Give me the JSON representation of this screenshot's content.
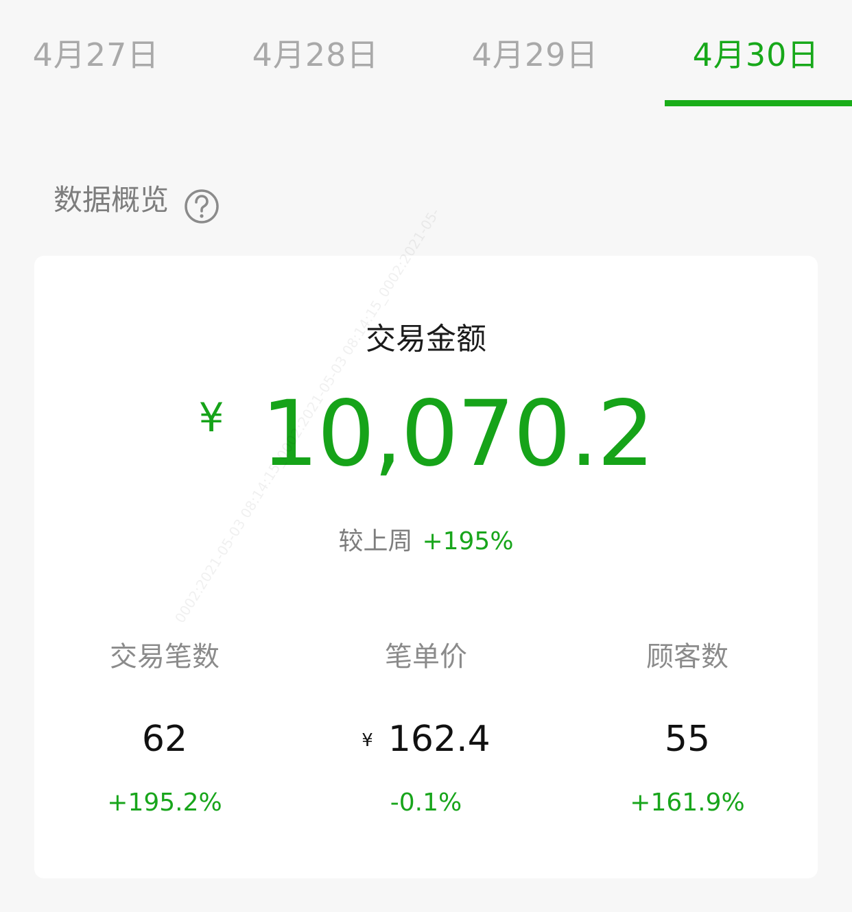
{
  "tabs": [
    {
      "label": "4月27日",
      "active": false
    },
    {
      "label": "4月28日",
      "active": false
    },
    {
      "label": "4月29日",
      "active": false
    },
    {
      "label": "4月30日",
      "active": true
    }
  ],
  "overview": {
    "title": "数据概览",
    "help_icon": "question-circle-icon"
  },
  "card": {
    "main_label": "交易金额",
    "currency": "¥",
    "amount": "10,070.2",
    "compare_label": "较上周",
    "compare_pct": "+195%",
    "metrics": [
      {
        "label": "交易笔数",
        "currency": "",
        "value": "62",
        "change": "+195.2%"
      },
      {
        "label": "笔单价",
        "currency": "¥",
        "value": "162.4",
        "change": "-0.1%"
      },
      {
        "label": "顾客数",
        "currency": "",
        "value": "55",
        "change": "+161.9%"
      }
    ]
  },
  "watermark": "0002:2021-05-03 08:14:15_0002:2021-05-03 08:14:15_0002:2021-05-",
  "colors": {
    "accent": "#1aad19",
    "tab_inactive": "#a9a9a9",
    "background": "#f7f7f7"
  }
}
